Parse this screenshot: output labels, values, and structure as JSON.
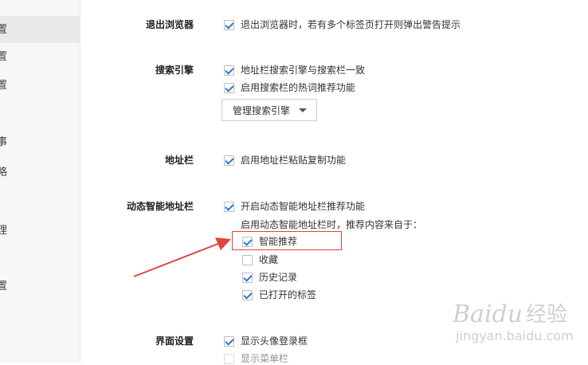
{
  "sidebar": {
    "fragments": [
      "置",
      "置",
      "置",
      "事",
      "略",
      "理",
      "置"
    ]
  },
  "sections": {
    "exit_browser": {
      "label": "退出浏览器",
      "options": [
        {
          "label": "退出浏览器时，若有多个标签页打开则弹出警告提示",
          "checked": true
        }
      ]
    },
    "search_engine": {
      "label": "搜索引擎",
      "options": [
        {
          "label": "地址栏搜索引擎与搜索栏一致",
          "checked": true
        },
        {
          "label": "启用搜索栏的热词推荐功能",
          "checked": true
        }
      ],
      "manage_button": "管理搜索引擎"
    },
    "address_bar": {
      "label": "地址栏",
      "options": [
        {
          "label": "启用地址栏粘贴复制功能",
          "checked": true
        }
      ]
    },
    "smart_bar": {
      "label": "动态智能地址栏",
      "main_option": {
        "label": "开启动态智能地址栏推荐功能",
        "checked": true
      },
      "sources_label": "启用动态智能地址栏时，推荐内容来自于：",
      "sources": [
        {
          "label": "智能推荐",
          "checked": true
        },
        {
          "label": "收藏",
          "checked": false
        },
        {
          "label": "历史记录",
          "checked": true
        },
        {
          "label": "已打开的标签",
          "checked": true
        }
      ]
    },
    "interface": {
      "label": "界面设置",
      "options": [
        {
          "label": "显示头像登录框",
          "checked": true
        },
        {
          "label": "显示菜单栏",
          "checked": false
        }
      ]
    }
  },
  "annotation": {
    "color": "#e0443c"
  },
  "watermark": {
    "brand_text": "Baidu",
    "brand_cn": "经验",
    "url": "jingyan.baidu.com"
  }
}
